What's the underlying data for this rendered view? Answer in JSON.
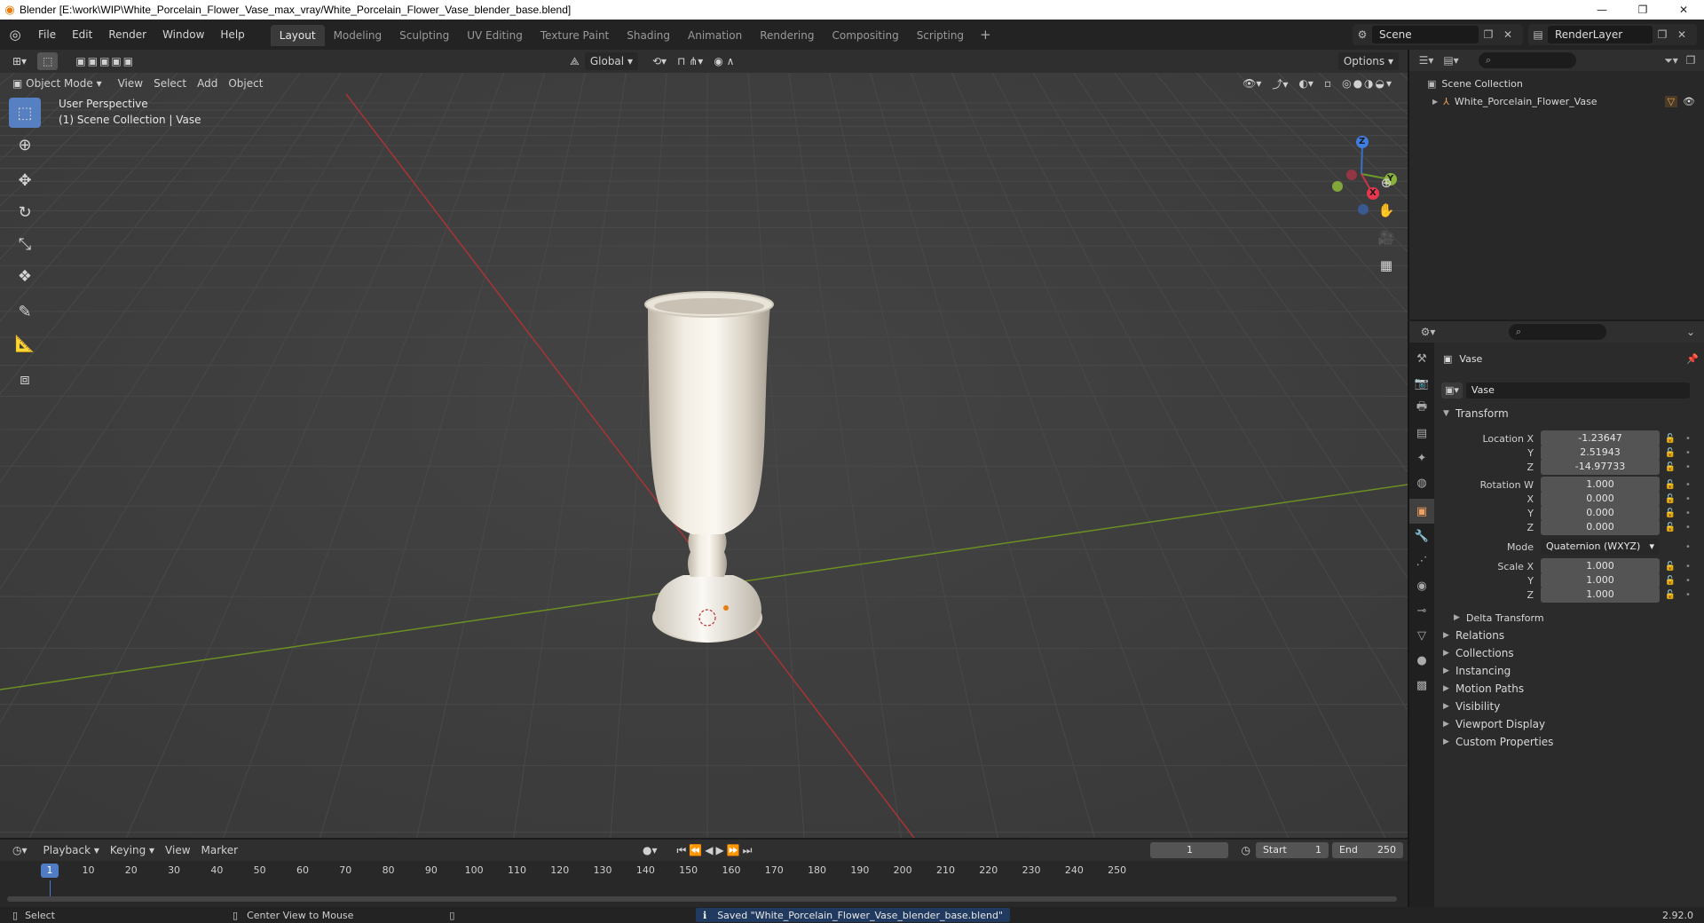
{
  "window": {
    "title": "Blender [E:\\work\\WIP\\White_Porcelain_Flower_Vase_max_vray/White_Porcelain_Flower_Vase_blender_base.blend]",
    "minimize": "—",
    "maximize": "❐",
    "close": "✕"
  },
  "menu": [
    "File",
    "Edit",
    "Render",
    "Window",
    "Help"
  ],
  "workspaces": [
    "Layout",
    "Modeling",
    "Sculpting",
    "UV Editing",
    "Texture Paint",
    "Shading",
    "Animation",
    "Rendering",
    "Compositing",
    "Scripting"
  ],
  "active_workspace": "Layout",
  "scene": {
    "name": "Scene",
    "view_layer": "RenderLayer"
  },
  "viewport": {
    "transform_orientation": "Global",
    "options_label": "Options",
    "mode": "Object Mode",
    "header_menus": [
      "View",
      "Select",
      "Add",
      "Object"
    ],
    "perspective_label": "User Perspective",
    "collection_label": "(1) Scene Collection | Vase",
    "gizmo_axes": {
      "x": "X",
      "y": "Y",
      "z": "Z"
    }
  },
  "outliner": {
    "root": "Scene Collection",
    "items": [
      {
        "name": "White_Porcelain_Flower_Vase"
      }
    ]
  },
  "properties": {
    "object_name": "Vase",
    "data_name": "Vase",
    "transform_title": "Transform",
    "location_label": "Location X",
    "location": {
      "x": "-1.23647",
      "y": "2.51943",
      "z": "-14.97733"
    },
    "rotation_label": "Rotation W",
    "rotation": {
      "w": "1.000",
      "x": "0.000",
      "y": "0.000",
      "z": "0.000"
    },
    "mode_label": "Mode",
    "mode_value": "Quaternion (WXYZ)",
    "scale_label": "Scale X",
    "scale": {
      "x": "1.000",
      "y": "1.000",
      "z": "1.000"
    },
    "axis_labels": {
      "x": "X",
      "y": "Y",
      "z": "Z"
    },
    "delta_transform": "Delta Transform",
    "panels": [
      "Relations",
      "Collections",
      "Instancing",
      "Motion Paths",
      "Visibility",
      "Viewport Display",
      "Custom Properties"
    ]
  },
  "timeline": {
    "menus": [
      "Playback",
      "Keying",
      "View",
      "Marker"
    ],
    "current_frame": "1",
    "start_label": "Start",
    "start": "1",
    "end_label": "End",
    "end": "250",
    "ticks": [
      "10",
      "20",
      "30",
      "40",
      "50",
      "60",
      "70",
      "80",
      "90",
      "100",
      "110",
      "120",
      "130",
      "140",
      "150",
      "160",
      "170",
      "180",
      "190",
      "200",
      "210",
      "220",
      "230",
      "240",
      "250"
    ]
  },
  "status": {
    "left_hint": "Select",
    "middle_hint": "Center View to Mouse",
    "message": "Saved \"White_Porcelain_Flower_Vase_blender_base.blend\"",
    "version": "2.92.0"
  }
}
